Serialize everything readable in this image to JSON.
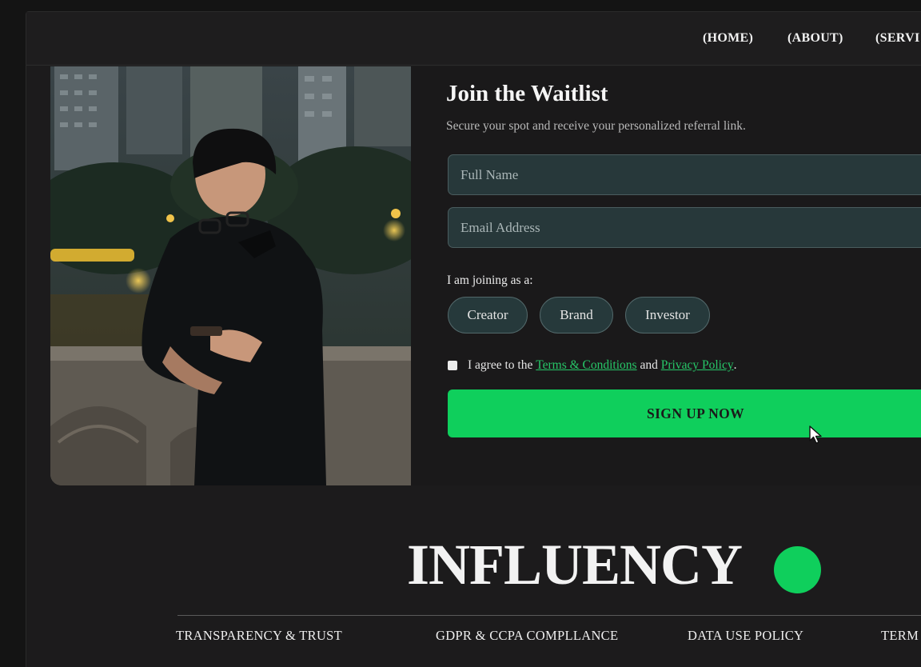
{
  "nav": {
    "items": [
      "(HOME)",
      "(ABOUT)",
      "(SERVI"
    ]
  },
  "form": {
    "title": "Join the Waitlist",
    "subtitle": "Secure your spot and receive your personalized referral link.",
    "full_name_placeholder": "Full Name",
    "full_name_value": "",
    "email_placeholder": "Email Address",
    "email_value": "",
    "role_label": "I am joining as a:",
    "roles": [
      "Creator",
      "Brand",
      "Investor"
    ],
    "agree_prefix": "I agree to the ",
    "terms_link": "Terms & Conditions",
    "agree_middle": " and ",
    "privacy_link": "Privacy Policy",
    "agree_suffix": ".",
    "agree_checked": false,
    "submit_label": "SIGN UP NOW"
  },
  "brand": {
    "name": "INFLUENCY",
    "dot_color": "#0fcf5c"
  },
  "footer": {
    "links": [
      "TRANSPARENCY & TRUST",
      "GDPR & CCPA COMPLLANCE",
      "DATA USE POLICY",
      "TERM"
    ]
  },
  "colors": {
    "accent": "#0fcf5c",
    "background": "#1c1b1c",
    "input_bg": "#27383a",
    "link": "#27c768"
  },
  "icons": [
    "pointer-cursor-icon"
  ]
}
